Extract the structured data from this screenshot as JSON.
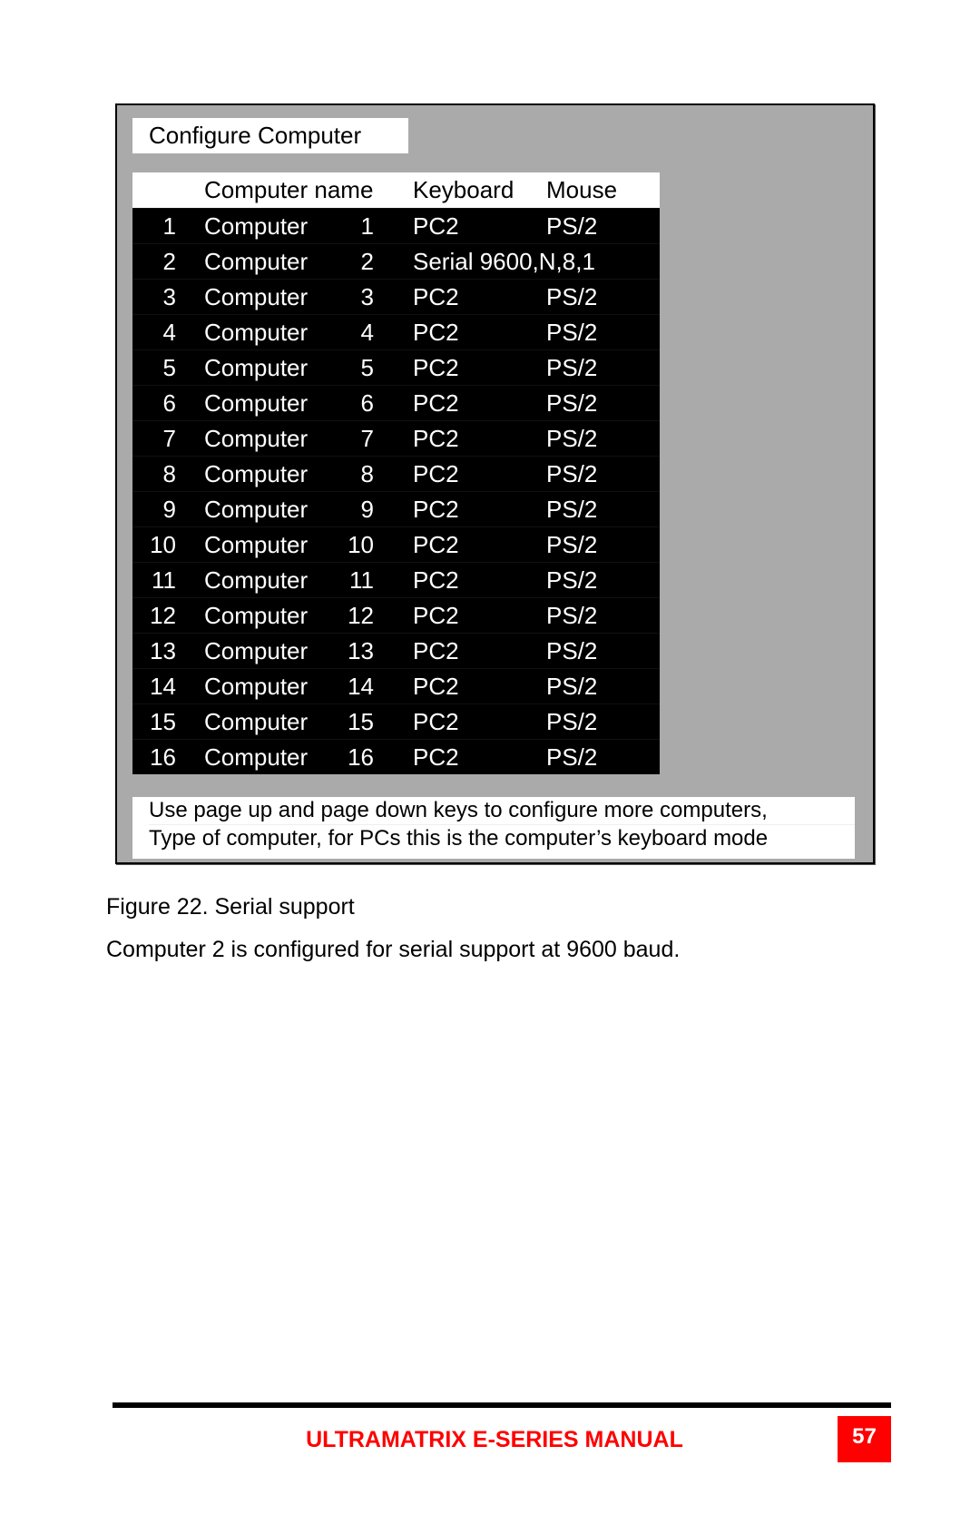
{
  "screen": {
    "title": "Configure Computer",
    "table": {
      "headers": {
        "name": "Computer name",
        "keyboard": "Keyboard",
        "mouse": "Mouse"
      },
      "rows": [
        {
          "num": "1",
          "name": "Computer",
          "name_num": "1",
          "keyboard": "PC2",
          "mouse": "PS/2"
        },
        {
          "num": "2",
          "name": "Computer",
          "name_num": "2",
          "keyboard": "Serial 9600,N,8,1",
          "mouse": ""
        },
        {
          "num": "3",
          "name": "Computer",
          "name_num": "3",
          "keyboard": "PC2",
          "mouse": "PS/2"
        },
        {
          "num": "4",
          "name": "Computer",
          "name_num": "4",
          "keyboard": "PC2",
          "mouse": "PS/2"
        },
        {
          "num": "5",
          "name": "Computer",
          "name_num": "5",
          "keyboard": "PC2",
          "mouse": "PS/2"
        },
        {
          "num": "6",
          "name": "Computer",
          "name_num": "6",
          "keyboard": "PC2",
          "mouse": "PS/2"
        },
        {
          "num": "7",
          "name": "Computer",
          "name_num": "7",
          "keyboard": "PC2",
          "mouse": "PS/2"
        },
        {
          "num": "8",
          "name": "Computer",
          "name_num": "8",
          "keyboard": "PC2",
          "mouse": "PS/2"
        },
        {
          "num": "9",
          "name": "Computer",
          "name_num": "9",
          "keyboard": "PC2",
          "mouse": "PS/2"
        },
        {
          "num": "10",
          "name": "Computer",
          "name_num": "10",
          "keyboard": "PC2",
          "mouse": "PS/2"
        },
        {
          "num": "11",
          "name": "Computer",
          "name_num": "11",
          "keyboard": "PC2",
          "mouse": "PS/2"
        },
        {
          "num": "12",
          "name": "Computer",
          "name_num": "12",
          "keyboard": "PC2",
          "mouse": "PS/2"
        },
        {
          "num": "13",
          "name": "Computer",
          "name_num": "13",
          "keyboard": "PC2",
          "mouse": "PS/2"
        },
        {
          "num": "14",
          "name": "Computer",
          "name_num": "14",
          "keyboard": "PC2",
          "mouse": "PS/2"
        },
        {
          "num": "15",
          "name": "Computer",
          "name_num": "15",
          "keyboard": "PC2",
          "mouse": "PS/2"
        },
        {
          "num": "16",
          "name": "Computer",
          "name_num": "16",
          "keyboard": "PC2",
          "mouse": "PS/2"
        }
      ]
    },
    "notes": [
      "Use page up and page down keys to configure more computers,",
      "Type of computer, for PCs this is the computer’s keyboard mode"
    ]
  },
  "document": {
    "caption": "Figure 22. Serial support",
    "body": "Computer 2 is configured for serial support at 9600 baud."
  },
  "footer": {
    "title": "ULTRAMATRIX E-SERIES MANUAL",
    "page_number": "57",
    "accent_color": "#ff0000"
  }
}
